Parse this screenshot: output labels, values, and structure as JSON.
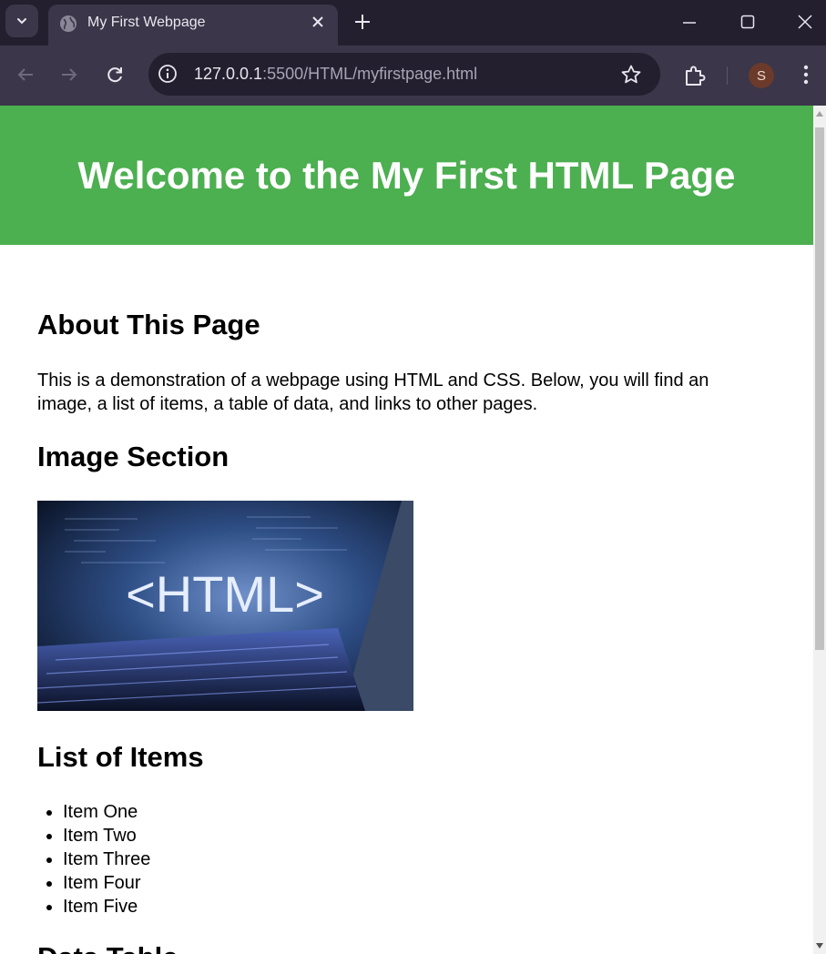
{
  "browser": {
    "tab_title": "My First Webpage",
    "url_host": "127.0.0.1",
    "url_rest": ":5500/HTML/myfirstpage.html",
    "profile_initial": "S"
  },
  "page": {
    "header_title": "Welcome to the My First HTML Page",
    "about_heading": "About This Page",
    "about_text": "This is a demonstration of a webpage using HTML and CSS. Below, you will find an image, a list of items, a table of data, and links to other pages.",
    "image_heading": "Image Section",
    "image_text": "<HTML>",
    "list_heading": "List of Items",
    "items": [
      "Item One",
      "Item Two",
      "Item Three",
      "Item Four",
      "Item Five"
    ],
    "table_heading": "Data Table"
  },
  "colors": {
    "header_green": "#4caf50",
    "chrome_dark": "#231f2e",
    "chrome_mid": "#3b3649"
  }
}
